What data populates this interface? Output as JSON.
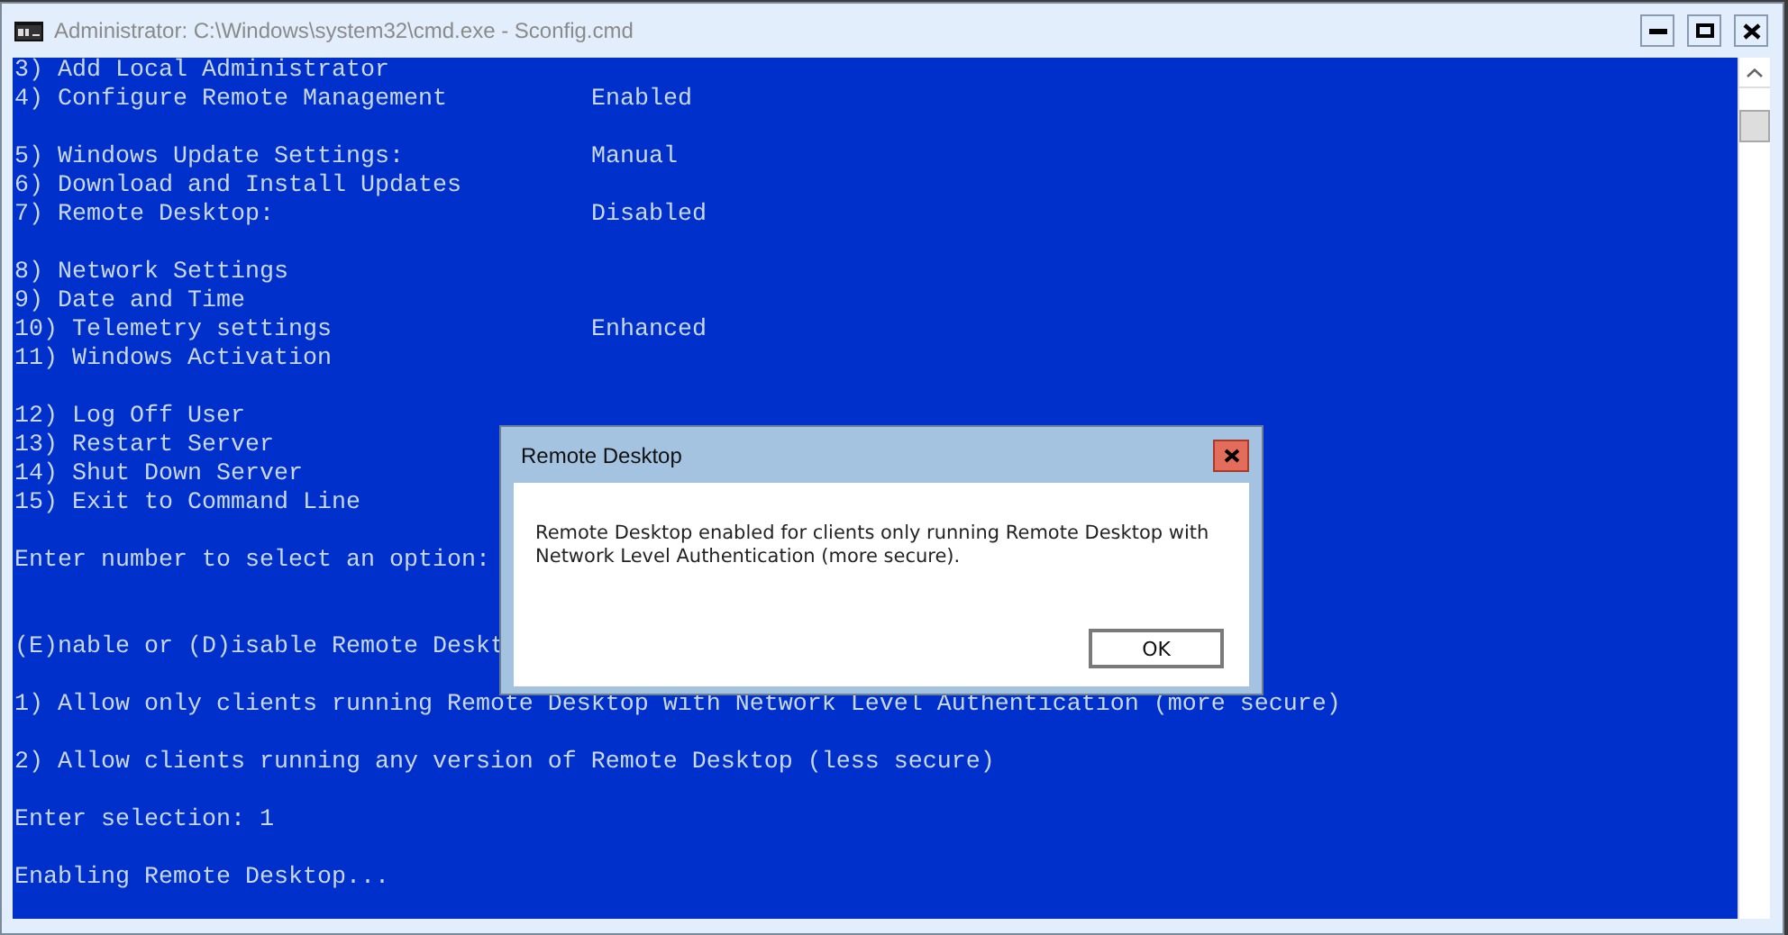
{
  "window": {
    "title": "Administrator: C:\\Windows\\system32\\cmd.exe - Sconfig.cmd"
  },
  "console": [
    {
      "kind": "line",
      "text": "3) Add Local Administrator"
    },
    {
      "kind": "line",
      "text": "4) Configure Remote Management",
      "value": "Enabled"
    },
    {
      "kind": "blank"
    },
    {
      "kind": "line",
      "text": "5) Windows Update Settings:",
      "value": "Manual"
    },
    {
      "kind": "line",
      "text": "6) Download and Install Updates"
    },
    {
      "kind": "line",
      "text": "7) Remote Desktop:",
      "value": "Disabled"
    },
    {
      "kind": "blank"
    },
    {
      "kind": "line",
      "text": "8) Network Settings"
    },
    {
      "kind": "line",
      "text": "9) Date and Time"
    },
    {
      "kind": "line",
      "text": "10) Telemetry settings",
      "value": "Enhanced"
    },
    {
      "kind": "line",
      "text": "11) Windows Activation"
    },
    {
      "kind": "blank"
    },
    {
      "kind": "line",
      "text": "12) Log Off User"
    },
    {
      "kind": "line",
      "text": "13) Restart Server"
    },
    {
      "kind": "line",
      "text": "14) Shut Down Server"
    },
    {
      "kind": "line",
      "text": "15) Exit to Command Line"
    },
    {
      "kind": "blank"
    },
    {
      "kind": "line",
      "text": "Enter number to select an option:"
    },
    {
      "kind": "blank"
    },
    {
      "kind": "blank"
    },
    {
      "kind": "line",
      "text": "(E)nable or (D)isable Remote Deskt"
    },
    {
      "kind": "blank"
    },
    {
      "kind": "line",
      "text": "1) Allow only clients running Remote Desktop with Network Level Authentication (more secure)"
    },
    {
      "kind": "blank"
    },
    {
      "kind": "line",
      "text": "2) Allow clients running any version of Remote Desktop (less secure)"
    },
    {
      "kind": "blank"
    },
    {
      "kind": "line",
      "text": "Enter selection: 1"
    },
    {
      "kind": "blank"
    },
    {
      "kind": "line",
      "text": "Enabling Remote Desktop..."
    }
  ],
  "dialog": {
    "title": "Remote Desktop",
    "message": "Remote Desktop enabled for clients only running Remote Desktop with Network Level Authentication (more secure).",
    "button": "OK"
  }
}
